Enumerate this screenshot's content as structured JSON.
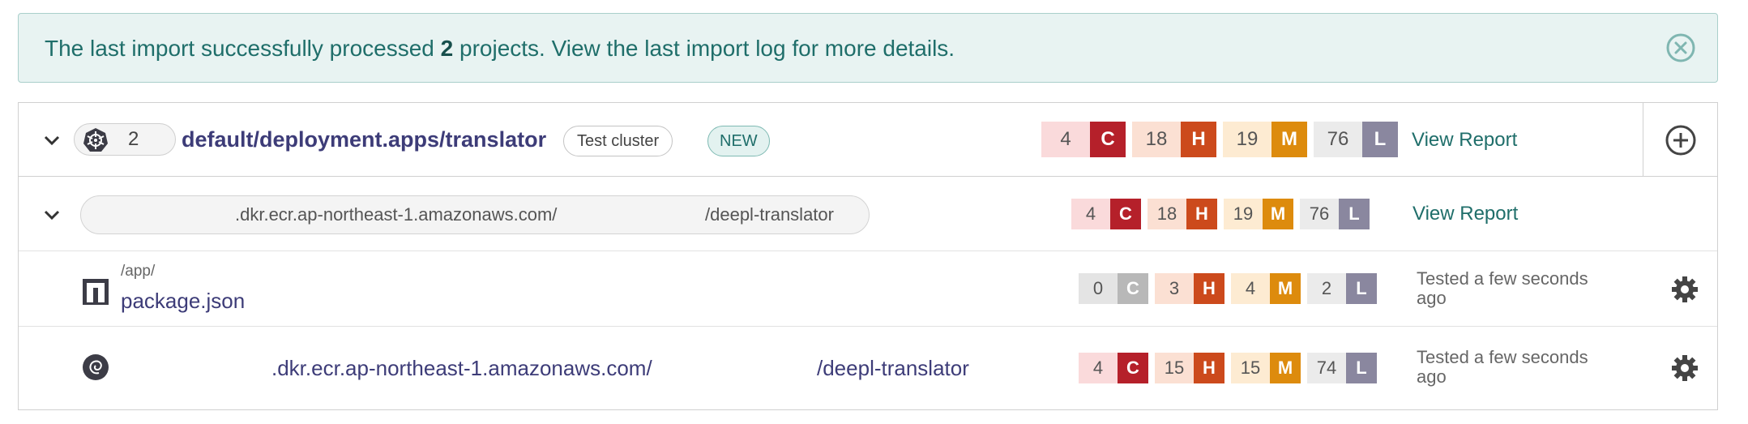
{
  "banner": {
    "text_before": "The last import successfully processed ",
    "count": "2",
    "text_middle": " projects. View the ",
    "link_text": "last import log",
    "text_after": " for more details."
  },
  "project": {
    "kube_count": "2",
    "title": "default/deployment.apps/translator",
    "cluster_tag": "Test cluster",
    "new_tag": "NEW",
    "severity": {
      "C": "4",
      "H": "18",
      "M": "19",
      "L": "76"
    },
    "view_report": "View Report"
  },
  "image_row": {
    "path_part1": ".dkr.ecr.ap-northeast-1.amazonaws.com/",
    "path_part2": "/deepl-translator",
    "severity": {
      "C": "4",
      "H": "18",
      "M": "19",
      "L": "76"
    },
    "view_report": "View Report"
  },
  "targets": [
    {
      "path": "/app/",
      "name": "package.json",
      "severity": {
        "C": "0",
        "H": "3",
        "M": "4",
        "L": "2"
      },
      "tested": "Tested a few seconds ago"
    },
    {
      "name_part1": ".dkr.ecr.ap-northeast-1.amazonaws.com/",
      "name_part2": "/deepl-translator",
      "severity": {
        "C": "4",
        "H": "15",
        "M": "15",
        "L": "74"
      },
      "tested": "Tested a few seconds ago"
    }
  ],
  "severity_letters": {
    "C": "C",
    "H": "H",
    "M": "M",
    "L": "L"
  },
  "colors": {
    "critical": "#b5202a",
    "high": "#cc4a1c",
    "medium": "#dd8b0d",
    "low": "#8a879f",
    "accent": "#1f6e6a",
    "title": "#3d3c78"
  },
  "icons": [
    "close-circle-icon",
    "chevron-down-icon",
    "kubernetes-icon",
    "add-circle-icon",
    "npm-icon",
    "debian-icon",
    "gear-icon"
  ]
}
